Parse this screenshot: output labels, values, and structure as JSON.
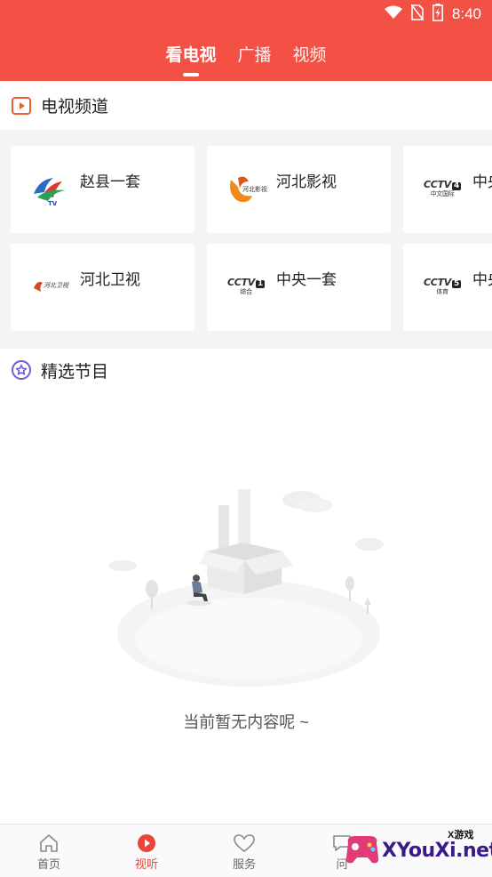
{
  "status": {
    "time": "8:40"
  },
  "tabs": [
    {
      "label": "看电视",
      "active": true
    },
    {
      "label": "广播",
      "active": false
    },
    {
      "label": "视频",
      "active": false
    }
  ],
  "tv_section": {
    "title": "电视频道",
    "icon": "play-icon"
  },
  "channels": [
    {
      "name": "赵县一套",
      "logo": "zhaoxian-logo"
    },
    {
      "name": "河北影视",
      "logo": "hebei-film-logo",
      "logo_text": "河北影视"
    },
    {
      "name": "中央",
      "logo": "cctv4-logo",
      "logo_text": "CCTV",
      "logo_num": "4",
      "logo_sub": "中文国际"
    },
    {
      "name": "河北卫视",
      "logo": "hebei-satellite-logo",
      "logo_text": "河北卫视"
    },
    {
      "name": "中央一套",
      "logo": "cctv1-logo",
      "logo_text": "CCTV",
      "logo_num": "1",
      "logo_sub": "综合"
    },
    {
      "name": "中央",
      "logo": "cctv5-logo",
      "logo_text": "CCTV",
      "logo_num": "5",
      "logo_sub": "体育"
    }
  ],
  "featured_section": {
    "title": "精选节目",
    "icon": "star-icon"
  },
  "empty_state": {
    "text": "当前暂无内容呢 ~"
  },
  "bottom_nav": [
    {
      "label": "首页",
      "icon": "home-icon",
      "active": false
    },
    {
      "label": "视听",
      "icon": "play-circle-icon",
      "active": true
    },
    {
      "label": "服务",
      "icon": "heart-icon",
      "active": false
    },
    {
      "label": "问",
      "icon": "chat-icon",
      "active": false
    }
  ],
  "watermark": {
    "brand": "XYouXi.net",
    "tag": "X游戏"
  },
  "colors": {
    "brand": "#f45146",
    "active_nav": "#e9453a"
  }
}
